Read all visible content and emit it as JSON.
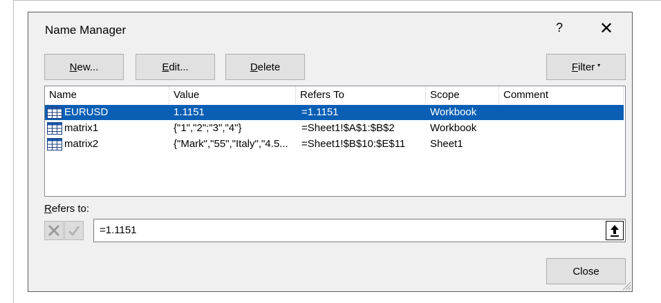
{
  "window": {
    "title": "Name Manager",
    "help_glyph": "?",
    "close_glyph": "✕"
  },
  "toolbar": {
    "new_key": "N",
    "new_rest": "ew...",
    "edit_key": "E",
    "edit_rest": "dit...",
    "delete_key": "D",
    "delete_rest": "elete",
    "filter_key": "F",
    "filter_rest": "ilter",
    "filter_caret": "▾"
  },
  "table": {
    "columns": [
      "Name",
      "Value",
      "Refers To",
      "Scope",
      "Comment"
    ],
    "rows": [
      {
        "name": "EURUSD",
        "value": "1.1151",
        "refers_to": "=1.1151",
        "scope": "Workbook",
        "comment": "",
        "selected": true
      },
      {
        "name": "matrix1",
        "value": "{\"1\",\"2\";\"3\",\"4\"}",
        "refers_to": "=Sheet1!$A$1:$B$2",
        "scope": "Workbook",
        "comment": "",
        "selected": false
      },
      {
        "name": "matrix2",
        "value": "{\"Mark\",\"55\",\"Italy\",\"4.5...",
        "refers_to": "=Sheet1!$B$10:$E$11",
        "scope": "Sheet1",
        "comment": "",
        "selected": false
      }
    ]
  },
  "refers_to": {
    "label_key": "R",
    "label_rest": "efers to:",
    "value": "=1.1151"
  },
  "footer": {
    "close_label": "Close"
  },
  "colors": {
    "selection": "#0a5fb5",
    "dialog_bg": "#f0f0f0",
    "button_bg": "#e1e1e1"
  },
  "icons": [
    "name-range-icon",
    "cancel-x-icon",
    "confirm-check-icon",
    "collapse-dialog-arrow-icon",
    "resize-grip-icon"
  ]
}
